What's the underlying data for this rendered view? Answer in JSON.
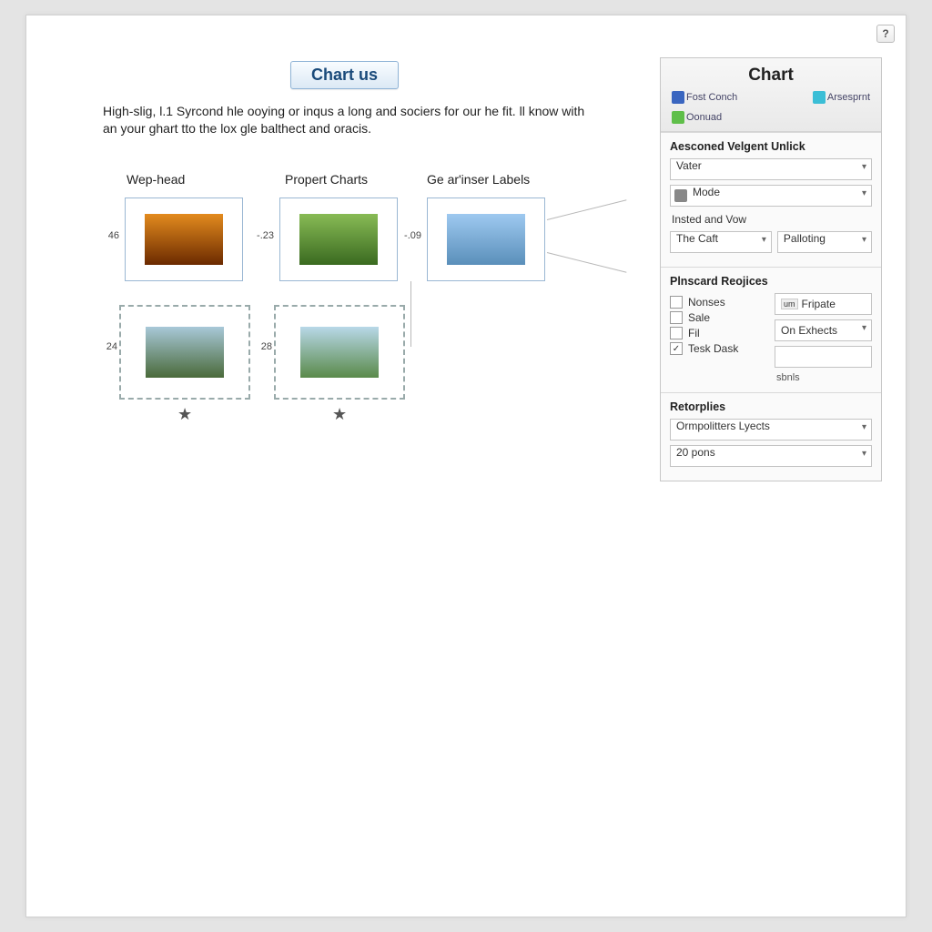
{
  "help": "?",
  "title": "Chart us",
  "intro": "High-slig, l.1 Syrcond hle ooying or inqus a long and sociers for our he fit. ll know with an your ghart tto the lox gle balthect and oracis.",
  "columns": [
    "Wep-head",
    "Propert Charts",
    "Ge ar'inser Labels"
  ],
  "thumbs": [
    {
      "num": "46"
    },
    {
      "num": "-.23"
    },
    {
      "num": "-.09"
    },
    {
      "num": "24"
    },
    {
      "num": "28"
    }
  ],
  "panel": {
    "title": "Chart",
    "icons": [
      {
        "label": "Fost Conch"
      },
      {
        "label": "Arsesprnt"
      },
      {
        "label": "Oonuad"
      }
    ],
    "sec1": {
      "title": "Aesconed Velgent Unlick",
      "d1": "Vater",
      "d2": "Mode",
      "stat": "Insted and Vow",
      "d3": "The Caft",
      "d4": "Palloting"
    },
    "sec2": {
      "title": "Plnscard Reojices",
      "c1": "Nonses",
      "c2": "Sale",
      "c3": "Fil",
      "c4": "Tesk Dask",
      "r1": "Fripate",
      "r2": "On Exhects",
      "r3": "",
      "r4": "sbnls"
    },
    "sec3": {
      "title": "Retorplies",
      "d1": "Ormpolitters Lyects",
      "d2": "20 pons"
    }
  }
}
